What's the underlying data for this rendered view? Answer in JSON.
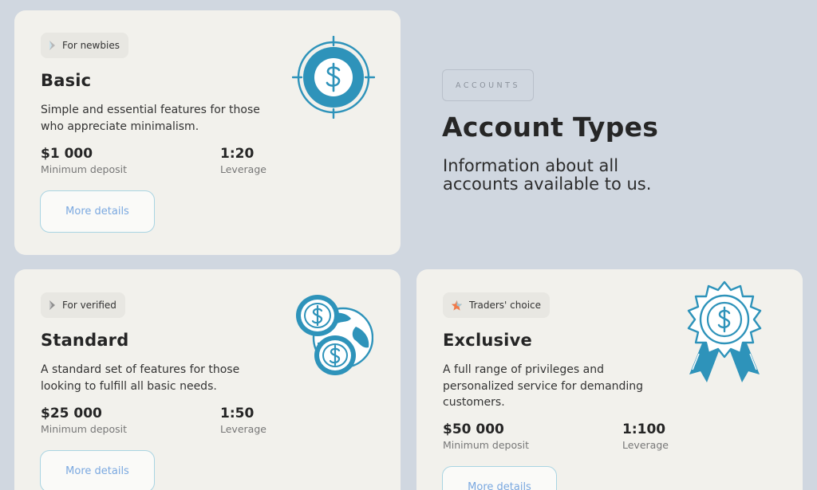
{
  "section": {
    "tag": "ACCOUNTS",
    "title": "Account Types",
    "subtitle": "Information about all accounts available to us."
  },
  "accounts": [
    {
      "badge": "For newbies",
      "badge_icon": "arrow-play-icon",
      "title": "Basic",
      "description": "Simple and essential features for those who appreciate minimalism.",
      "deposit_value": "$1 000",
      "deposit_label": "Minimum deposit",
      "leverage_value": "1:20",
      "leverage_label": "Leverage",
      "button_label": "More details",
      "illustration": "dollar-coin-target-icon"
    },
    {
      "badge": "For verified",
      "badge_icon": "arrow-play-icon",
      "title": "Standard",
      "description": "A standard set of features for those looking to fulfill all basic needs.",
      "deposit_value": "$25 000",
      "deposit_label": "Minimum deposit",
      "leverage_value": "1:50",
      "leverage_label": "Leverage",
      "button_label": "More details",
      "illustration": "coins-globe-icon"
    },
    {
      "badge": "Traders' choice",
      "badge_icon": "star-icon",
      "title": "Exclusive",
      "description": "A full range of privileges and personalized service for demanding customers.",
      "deposit_value": "$50 000",
      "deposit_label": "Minimum deposit",
      "leverage_value": "1:100",
      "leverage_label": "Leverage",
      "button_label": "More details",
      "illustration": "dollar-award-ribbon-icon"
    }
  ],
  "colors": {
    "background": "#d0d7e0",
    "card": "#f2f1ec",
    "accent": "#2e93ba",
    "button_text": "#7aa8e0",
    "star": "#f07a4a"
  }
}
